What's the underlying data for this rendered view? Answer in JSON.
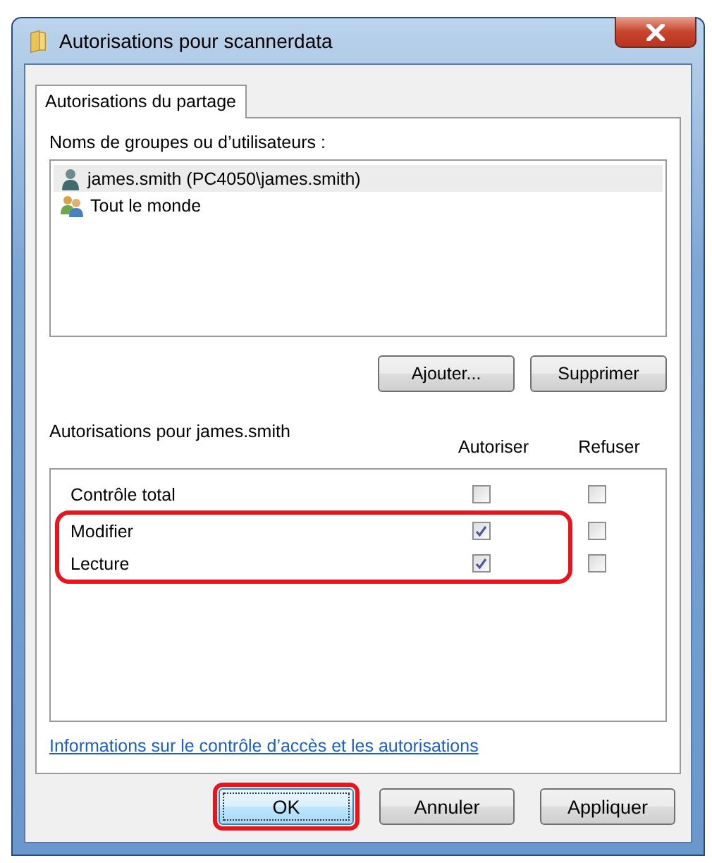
{
  "window": {
    "title": "Autorisations pour scannerdata"
  },
  "tabs": [
    {
      "label": "Autorisations du partage",
      "selected": true
    }
  ],
  "users": {
    "label": "Noms de groupes ou d’utilisateurs :",
    "items": [
      {
        "name": "james.smith (PC4050\\james.smith)",
        "kind": "user",
        "selected": true
      },
      {
        "name": "Tout le monde",
        "kind": "group",
        "selected": false
      }
    ]
  },
  "user_buttons": [
    "Ajouter...",
    "Supprimer"
  ],
  "permissions": {
    "label": "Autorisations pour james.smith",
    "columns": [
      "Autoriser",
      "Refuser"
    ],
    "rows": [
      {
        "name": "Contrôle total",
        "allow": false,
        "deny": false,
        "highlighted": false
      },
      {
        "name": "Modifier",
        "allow": true,
        "deny": false,
        "highlighted": true
      },
      {
        "name": "Lecture",
        "allow": true,
        "deny": false,
        "highlighted": true
      }
    ]
  },
  "help_link": "Informations sur le contrôle d’accès et les autorisations",
  "buttons": [
    {
      "label": "OK",
      "default": true,
      "highlighted": true
    },
    {
      "label": "Annuler",
      "default": false,
      "highlighted": false
    },
    {
      "label": "Appliquer",
      "default": false,
      "highlighted": false
    }
  ]
}
